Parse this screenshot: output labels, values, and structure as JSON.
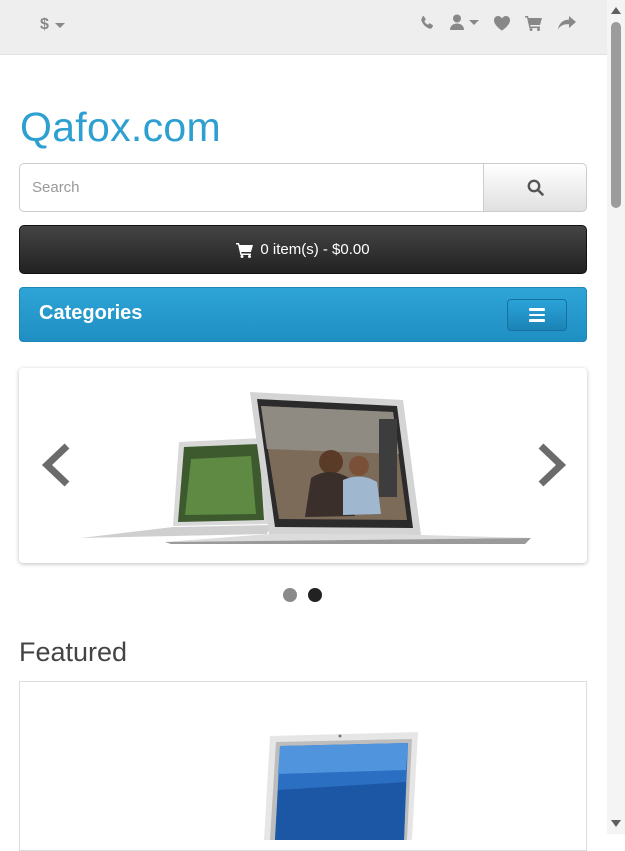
{
  "header": {
    "currency_symbol": "$",
    "icons": [
      "phone-icon",
      "user-icon",
      "heart-icon",
      "cart-icon",
      "share-icon"
    ]
  },
  "logo": {
    "text": "Qafox.com",
    "color": "#2d9fd1"
  },
  "search": {
    "placeholder": "Search",
    "value": ""
  },
  "cart": {
    "label": "0 item(s) - $0.00"
  },
  "categories": {
    "title": "Categories"
  },
  "slideshow": {
    "total_slides": 2,
    "active_slide": 2
  },
  "featured": {
    "title": "Featured"
  },
  "colors": {
    "accent": "#2d9fd1",
    "cart_bg": "#333333",
    "topbar_bg": "#eeeeee"
  }
}
